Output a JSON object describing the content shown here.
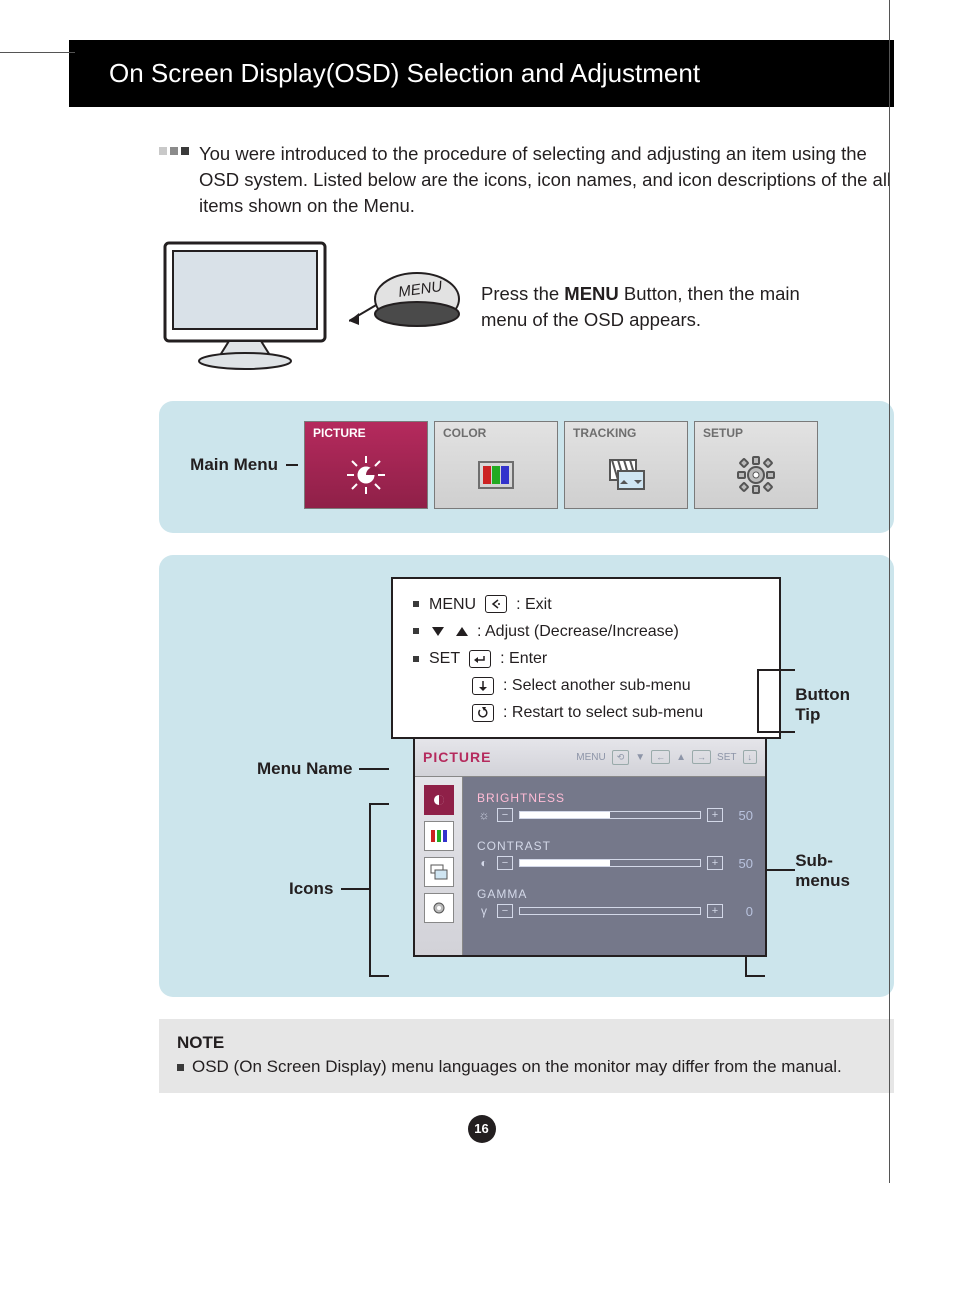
{
  "header": "On Screen Display(OSD) Selection and Adjustment",
  "intro": "You were introduced to the procedure of selecting and adjusting an item using the OSD system. Listed below are the icons, icon names, and icon descriptions of the all items shown on the Menu.",
  "monitor_btn_label": "MENU",
  "press_text_prefix": "Press the ",
  "press_text_strong": "MENU",
  "press_text_suffix": " Button, then the main menu of the OSD appears.",
  "labels": {
    "main_menu": "Main Menu",
    "menu_name": "Menu Name",
    "icons": "Icons",
    "button_tip": "Button\nTip",
    "sub_menus": "Sub-\nmenus"
  },
  "main_menu": {
    "items": [
      {
        "label": "PICTURE",
        "active": true
      },
      {
        "label": "COLOR",
        "active": false
      },
      {
        "label": "TRACKING",
        "active": false
      },
      {
        "label": "SETUP",
        "active": false
      }
    ]
  },
  "button_tips": {
    "menu": {
      "prefix": "MENU",
      "desc": ": Exit"
    },
    "adjust": {
      "desc": ": Adjust (Decrease/Increase)"
    },
    "set": {
      "prefix": "SET",
      "desc": ": Enter"
    },
    "select": {
      "desc": ": Select another sub-menu"
    },
    "restart": {
      "desc": ": Restart to select sub-menu"
    }
  },
  "osd": {
    "menu_name": "PICTURE",
    "topbar_btns": {
      "menu": "MENU",
      "set": "SET"
    },
    "settings": [
      {
        "name": "BRIGHTNESS",
        "value": 50,
        "fill_pct": 50,
        "highlight": true,
        "icon": "sun"
      },
      {
        "name": "CONTRAST",
        "value": 50,
        "fill_pct": 50,
        "highlight": false,
        "icon": "contrast"
      },
      {
        "name": "GAMMA",
        "value": 0,
        "fill_pct": 0,
        "highlight": false,
        "icon": "gamma"
      }
    ]
  },
  "note": {
    "title": "NOTE",
    "text": "OSD (On Screen Display) menu languages on the monitor may differ from the manual."
  },
  "page_number": "16"
}
